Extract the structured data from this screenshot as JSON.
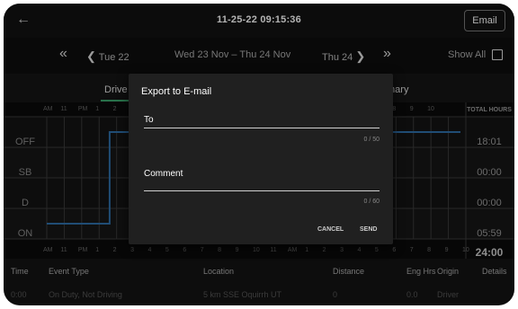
{
  "app": {
    "title": "11-25-22 09:15:36",
    "email_label": "Email",
    "back_icon": "arrow-left-icon"
  },
  "date_nav": {
    "prev_week": "«",
    "prev_day": "Tue 22",
    "current_range": "Wed 23 Nov – Thu 24 Nov",
    "next_day": "Thu 24",
    "next_week": "»",
    "show_all_label": "Show All",
    "show_all_checked": false
  },
  "tabs": {
    "driver": "Drive",
    "summary": "mary"
  },
  "graph": {
    "hour_labels_top": [
      "AM",
      "11",
      "PM",
      "1",
      "2",
      "",
      "",
      "",
      "",
      "",
      "",
      "",
      "",
      "",
      "",
      "",
      "",
      "",
      "",
      "7",
      "8",
      "9",
      "10"
    ],
    "hour_labels_bottom": [
      "AM",
      "11",
      "PM",
      "1",
      "2",
      "3",
      "4",
      "5",
      "6",
      "7",
      "8",
      "9",
      "10",
      "11",
      "AM",
      "1",
      "2",
      "3",
      "4",
      "5",
      "6",
      "7",
      "8",
      "9",
      "10"
    ],
    "total_header": "TOTAL HOURS",
    "rows": [
      {
        "label": "OFF",
        "total": "18:01"
      },
      {
        "label": "SB",
        "total": "00:00"
      },
      {
        "label": "D",
        "total": "00:00"
      },
      {
        "label": "ON",
        "total": "05:59"
      }
    ],
    "grand_total": "24:00",
    "line_color": "#2f6fa8"
  },
  "events": {
    "columns": [
      "Time",
      "Event Type",
      "Location",
      "Distance",
      "Eng Hrs",
      "Origin",
      "Details"
    ],
    "rows": [
      [
        "0:00",
        "On Duty, Not Driving",
        "5 km SSE Oquirrh UT",
        "0",
        "0.0",
        "Driver",
        ""
      ]
    ]
  },
  "modal": {
    "title": "Export to E-mail",
    "to_label": "To",
    "to_counter": "0 / 50",
    "comment_label": "Comment",
    "comment_counter": "0 / 60",
    "cancel_label": "CANCEL",
    "send_label": "SEND"
  }
}
